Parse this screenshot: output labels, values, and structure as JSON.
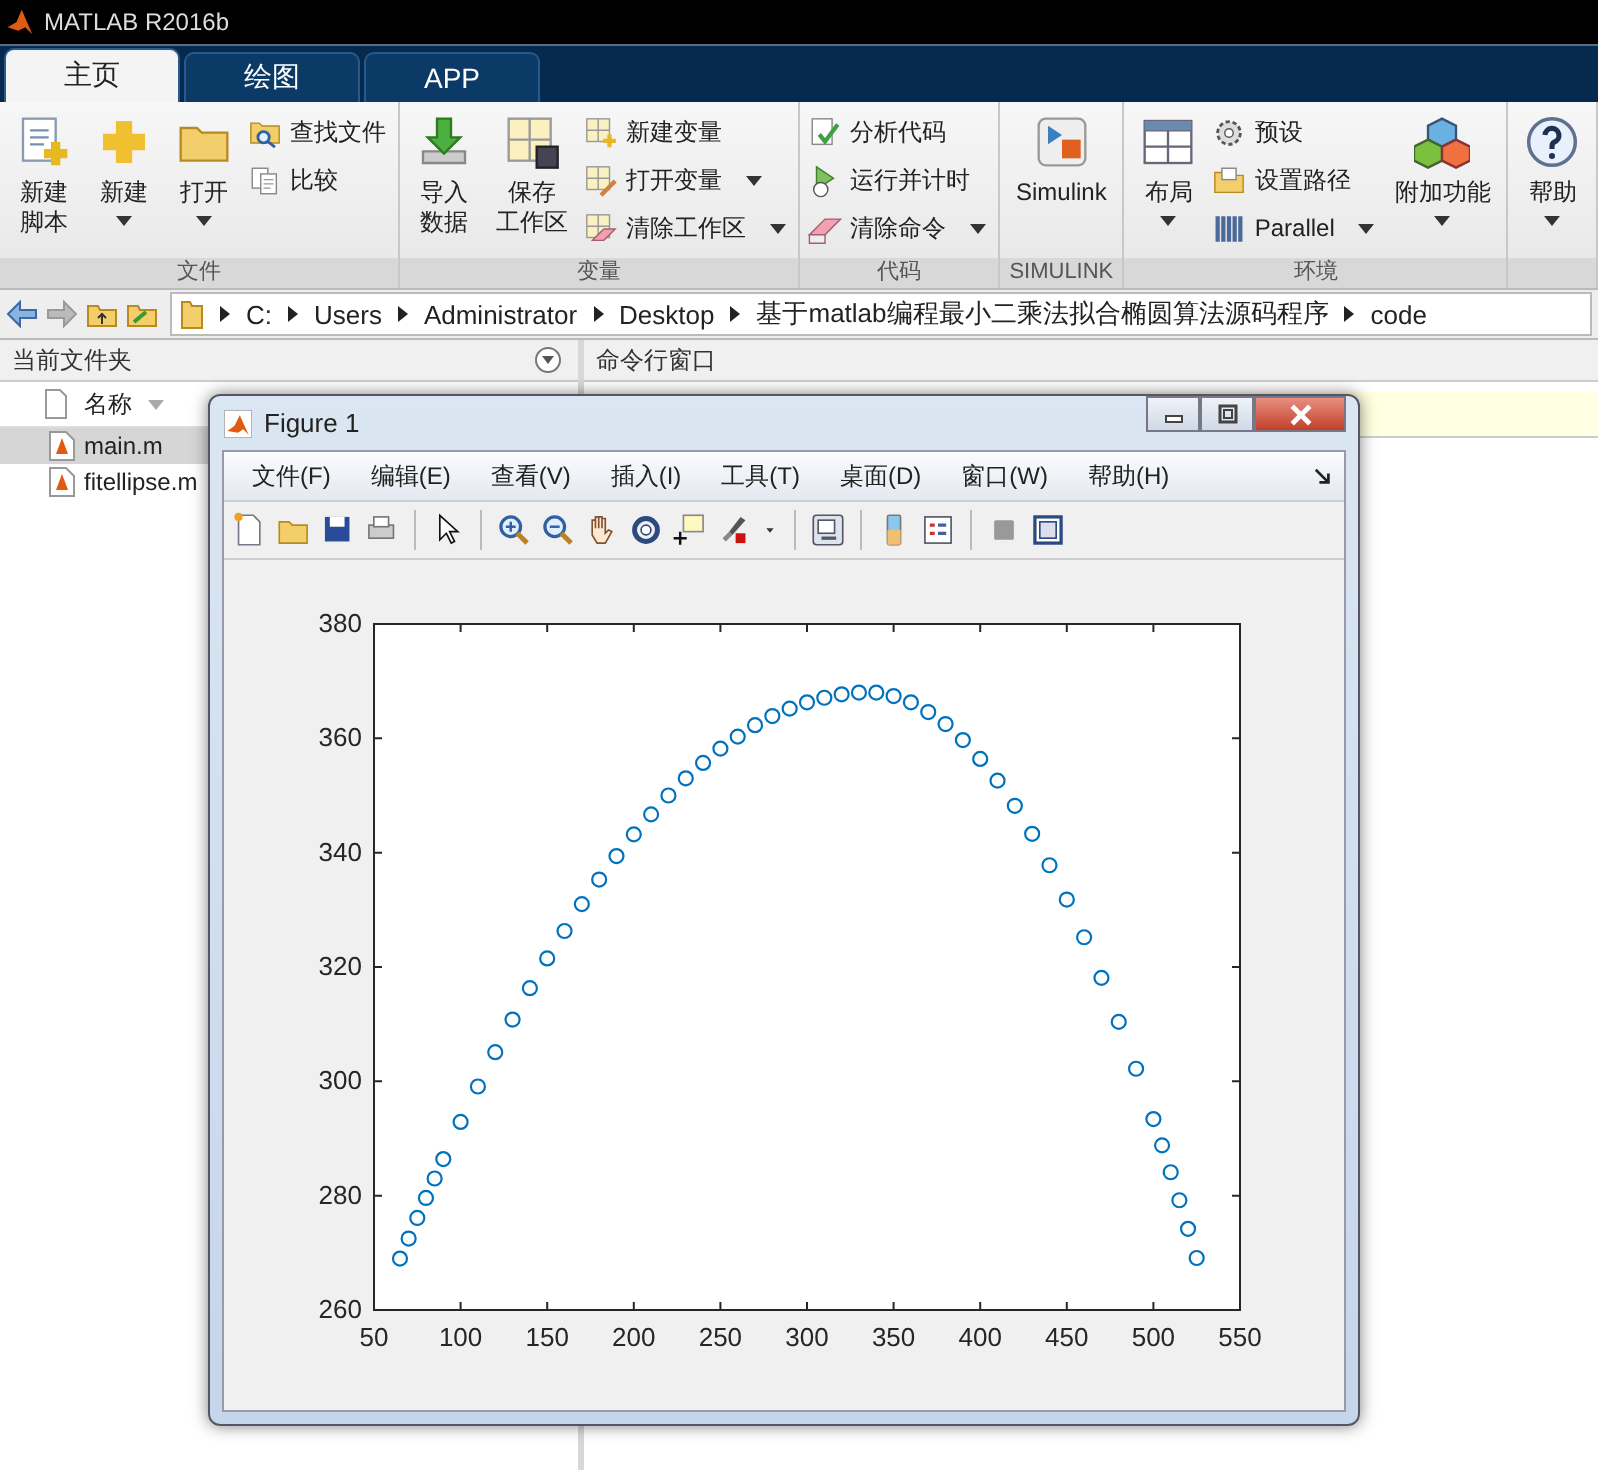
{
  "app": {
    "title": "MATLAB R2016b"
  },
  "tabs": [
    {
      "label": "主页",
      "selected": true
    },
    {
      "label": "绘图",
      "selected": false
    },
    {
      "label": "APP",
      "selected": false
    }
  ],
  "ribbon": {
    "sections": [
      {
        "label": "文件",
        "columns": [
          {
            "kind": "large",
            "lines": [
              "新建",
              "脚本"
            ],
            "dropdown": false
          },
          {
            "kind": "large",
            "lines": [
              "新建"
            ],
            "dropdown": true
          },
          {
            "kind": "large",
            "lines": [
              "打开"
            ],
            "dropdown": true
          },
          {
            "kind": "stack",
            "items": [
              {
                "label": "查找文件",
                "dropdown": false
              },
              {
                "label": "比较",
                "dropdown": false
              }
            ]
          }
        ]
      },
      {
        "label": "变量",
        "columns": [
          {
            "kind": "large",
            "lines": [
              "导入",
              "数据"
            ],
            "dropdown": false
          },
          {
            "kind": "large",
            "lines": [
              "保存",
              "工作区"
            ],
            "dropdown": false
          },
          {
            "kind": "stack",
            "items": [
              {
                "label": "新建变量",
                "dropdown": false
              },
              {
                "label": "打开变量",
                "dropdown": true
              },
              {
                "label": "清除工作区",
                "dropdown": true
              }
            ]
          }
        ]
      },
      {
        "label": "代码",
        "columns": [
          {
            "kind": "stack",
            "items": [
              {
                "label": "分析代码",
                "dropdown": false
              },
              {
                "label": "运行并计时",
                "dropdown": false
              },
              {
                "label": "清除命令",
                "dropdown": true
              }
            ]
          }
        ]
      },
      {
        "label": "SIMULINK",
        "columns": [
          {
            "kind": "large",
            "lines": [
              "Simulink"
            ],
            "dropdown": false
          }
        ]
      },
      {
        "label": "环境",
        "columns": [
          {
            "kind": "large",
            "lines": [
              "布局"
            ],
            "dropdown": true
          },
          {
            "kind": "stack",
            "items": [
              {
                "label": "预设",
                "dropdown": false
              },
              {
                "label": "设置路径",
                "dropdown": false
              },
              {
                "label": "Parallel",
                "dropdown": true
              }
            ]
          },
          {
            "kind": "large",
            "lines": [
              "附加功能"
            ],
            "dropdown": true
          }
        ]
      },
      {
        "columns": [
          {
            "kind": "large",
            "lines": [
              "帮助"
            ],
            "dropdown": true
          }
        ]
      }
    ]
  },
  "address_bar": {
    "path": [
      "C:",
      "Users",
      "Administrator",
      "Desktop",
      "基于matlab编程最小二乘法拟合椭圆算法源码程序",
      "code"
    ]
  },
  "current_folder": {
    "title": "当前文件夹",
    "column": "名称",
    "files": [
      {
        "name": "main.m",
        "selected": true
      },
      {
        "name": "fitellipse.m",
        "selected": false
      }
    ]
  },
  "command_window": {
    "title": "命令行窗口"
  },
  "figure": {
    "title": "Figure 1",
    "menu": [
      "文件(F)",
      "编辑(E)",
      "查看(V)",
      "插入(I)",
      "工具(T)",
      "桌面(D)",
      "窗口(W)",
      "帮助(H)"
    ],
    "chart_data": {
      "type": "scatter",
      "xlim": [
        50,
        550
      ],
      "ylim": [
        260,
        380
      ],
      "xticks": [
        50,
        100,
        150,
        200,
        250,
        300,
        350,
        400,
        450,
        500,
        550
      ],
      "yticks": [
        260,
        280,
        300,
        320,
        340,
        360,
        380
      ],
      "x": [
        65,
        70,
        75,
        80,
        85,
        90,
        100,
        110,
        120,
        130,
        140,
        150,
        160,
        170,
        180,
        190,
        200,
        210,
        220,
        230,
        240,
        250,
        260,
        270,
        280,
        290,
        300,
        310,
        320,
        330,
        340,
        350,
        360,
        370,
        380,
        390,
        400,
        410,
        420,
        430,
        440,
        450,
        460,
        470,
        480,
        490,
        500,
        505,
        510,
        515,
        520,
        525
      ],
      "series": [
        {
          "color": "#0072bd",
          "values": [
            269,
            272.5,
            276.1,
            279.6,
            283,
            286.4,
            292.9,
            299.1,
            305.1,
            310.8,
            316.3,
            321.5,
            326.3,
            331,
            335.3,
            339.4,
            343.2,
            346.7,
            350,
            353,
            355.7,
            358.2,
            360.3,
            362.3,
            363.9,
            365.2,
            366.3,
            367.1,
            367.7,
            368,
            368,
            367.4,
            366.3,
            364.6,
            362.5,
            359.7,
            356.4,
            352.6,
            348.2,
            343.3,
            337.8,
            331.8,
            325.2,
            318.1,
            310.4,
            302.2,
            293.4,
            288.8,
            284.1,
            279.2,
            274.2,
            269.1
          ]
        }
      ]
    }
  }
}
